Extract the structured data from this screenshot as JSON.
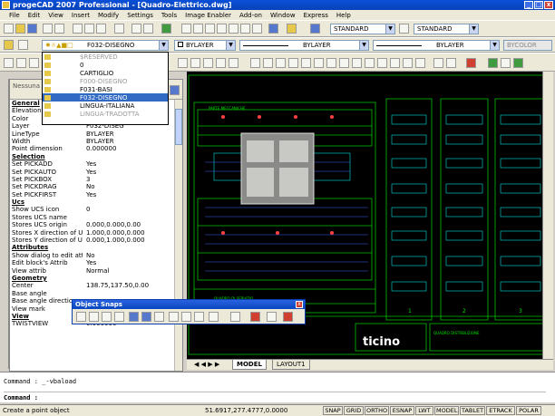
{
  "window": {
    "title": "progeCAD 2007 Professional - [Quadro-Elettrico.dwg]"
  },
  "menu": [
    "File",
    "Edit",
    "View",
    "Insert",
    "Modify",
    "Settings",
    "Tools",
    "Image Enabler",
    "Add-on",
    "Window",
    "Express",
    "Help"
  ],
  "toolbar": {
    "style1": "STANDARD",
    "style2": "STANDARD",
    "layer": "F032-DISEGNO",
    "color": "BYLAYER",
    "linetype": "BYLAYER",
    "lineweight": "BYLAYER",
    "bycolor": "BYCOLOR"
  },
  "layers": [
    {
      "name": "$RESERVED",
      "gray": true
    },
    {
      "name": "0",
      "gray": false
    },
    {
      "name": "CARTIGLIO",
      "gray": false
    },
    {
      "name": "F000-DISEGNO",
      "gray": true
    },
    {
      "name": "F031-BASI",
      "gray": false
    },
    {
      "name": "F032-DISEGNO",
      "gray": false,
      "selected": true
    },
    {
      "name": "LINGUA-ITALIANA",
      "gray": false
    },
    {
      "name": "LINGUA-TRADOTTA",
      "gray": true
    }
  ],
  "props_header": "Nessuna Selezione",
  "properties": [
    {
      "k": "General",
      "v": "",
      "sec": true
    },
    {
      "k": "Elevation",
      "v": ""
    },
    {
      "k": "Color",
      "v": ""
    },
    {
      "k": "Layer",
      "v": "F032-DISEG"
    },
    {
      "k": "LineType",
      "v": "BYLAYER"
    },
    {
      "k": "Width",
      "v": "BYLAYER"
    },
    {
      "k": "Point dimension",
      "v": "0.000000"
    },
    {
      "k": "Selection",
      "v": "",
      "sec": true
    },
    {
      "k": "Set PICKADD",
      "v": "Yes"
    },
    {
      "k": "Set PICKAUTO",
      "v": "Yes"
    },
    {
      "k": "Set PICKBOX",
      "v": "3"
    },
    {
      "k": "Set PICKDRAG",
      "v": "No"
    },
    {
      "k": "Set PICKFIRST",
      "v": "Yes"
    },
    {
      "k": "Ucs",
      "v": "",
      "sec": true
    },
    {
      "k": "Show UCS icon",
      "v": "0"
    },
    {
      "k": "Stores UCS name",
      "v": ""
    },
    {
      "k": "Stores UCS origin",
      "v": "0.000,0.000,0.00"
    },
    {
      "k": "Stores X direction of UCS",
      "v": "1.000,0.000,0.000"
    },
    {
      "k": "Stores Y direction of UCS",
      "v": "0.000,1.000,0.000"
    },
    {
      "k": "Attributes",
      "v": "",
      "sec": true
    },
    {
      "k": "Show dialog to edit attrib",
      "v": "No"
    },
    {
      "k": "Edit block's Attrib",
      "v": "Yes"
    },
    {
      "k": "View attrib",
      "v": "Normal"
    },
    {
      "k": "Geometry",
      "v": "",
      "sec": true
    },
    {
      "k": "Center",
      "v": "138.75,137.50,0.00"
    },
    {
      "k": "Base angle",
      "v": ""
    },
    {
      "k": "Base angle direction",
      "v": ""
    },
    {
      "k": "View mark",
      "v": ""
    },
    {
      "k": "View",
      "v": "",
      "sec": true
    },
    {
      "k": "TWISTVIEW",
      "v": "0.000000"
    }
  ],
  "drawing": {
    "label_top": "PARTE MECCANICHE",
    "label_mid": "QUADRO DI SERVIZIO",
    "brand": "ticino",
    "cartiglio": [
      "QUADRO DISTRIBUZIONE"
    ],
    "columns": [
      "1",
      "2",
      "3"
    ]
  },
  "tabs": [
    "MODEL",
    "LAYOUT1"
  ],
  "snaps": {
    "title": "Object Snaps",
    "close": "x"
  },
  "command": {
    "line1": "Command : _-vbaload",
    "line2": "Command :"
  },
  "status": {
    "message": "Create a point object",
    "coords": "51.6917,277.4777,0.0000",
    "buttons": [
      "SNAP",
      "GRID",
      "ORTHO",
      "ESNAP",
      "LWT",
      "MODEL",
      "TABLET",
      "ETRACK",
      "POLAR"
    ]
  }
}
